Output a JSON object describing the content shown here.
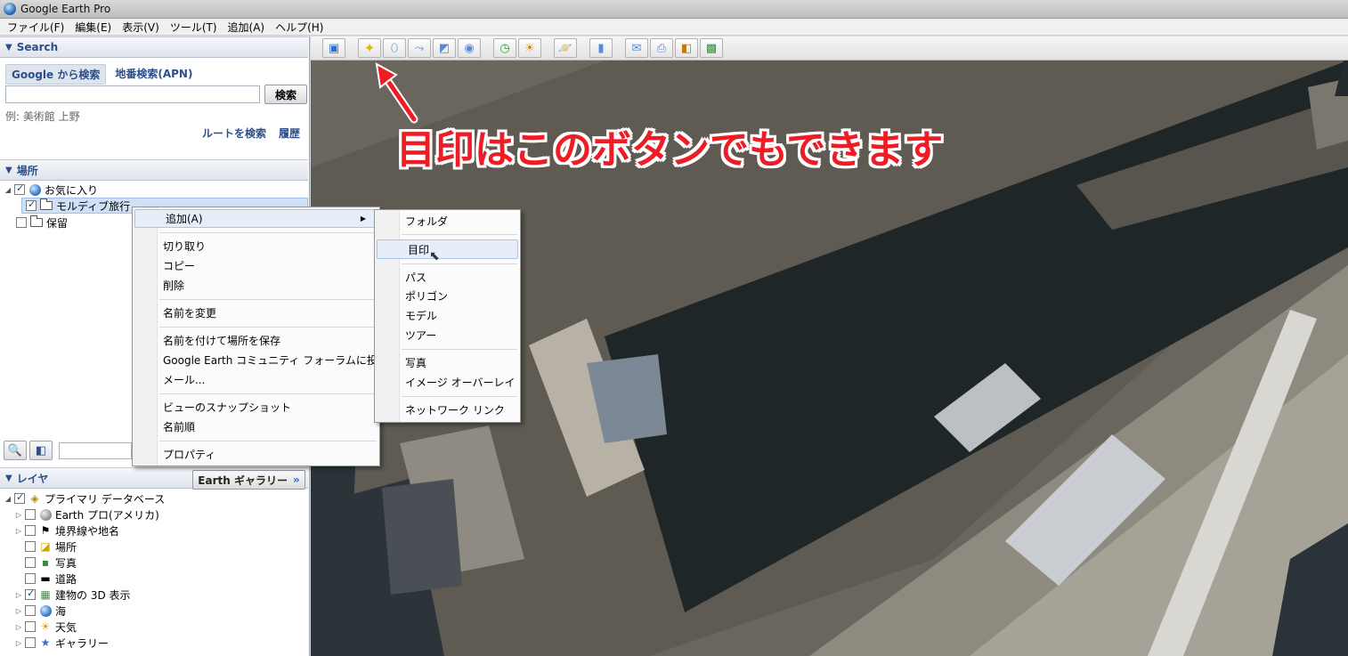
{
  "window": {
    "title": "Google Earth Pro"
  },
  "menu": [
    "ファイル(F)",
    "編集(E)",
    "表示(V)",
    "ツール(T)",
    "追加(A)",
    "ヘルプ(H)"
  ],
  "search": {
    "header": "Search",
    "tabs": [
      "Google から検索",
      "地番検索(APN)"
    ],
    "button": "検索",
    "example": "例: 美術館 上野",
    "route_link": "ルートを検索",
    "history_link": "履歴"
  },
  "places": {
    "header": "場所",
    "items": [
      {
        "label": "お気に入り",
        "checked": true
      },
      {
        "label": "モルディブ旅行",
        "checked": true
      },
      {
        "label": "保留",
        "checked": false
      }
    ]
  },
  "layers": {
    "header": "レイヤ",
    "gallery_button": "Earth ギャラリー",
    "gallery_arrow": "»",
    "items": [
      {
        "label": "プライマリ データベース",
        "checked": true
      },
      {
        "label": "Earth プロ(アメリカ)",
        "checked": false
      },
      {
        "label": "境界線や地名",
        "checked": false
      },
      {
        "label": "場所",
        "checked": false
      },
      {
        "label": "写真",
        "checked": false
      },
      {
        "label": "道路",
        "checked": false
      },
      {
        "label": "建物の 3D 表示",
        "checked": true
      },
      {
        "label": "海",
        "checked": false
      },
      {
        "label": "天気",
        "checked": false
      },
      {
        "label": "ギャラリー",
        "checked": false
      }
    ]
  },
  "context_menu": {
    "items": [
      "追加(A)",
      "切り取り",
      "コピー",
      "削除",
      "名前を変更",
      "名前を付けて場所を保存",
      "Google Earth コミュニティ フォーラムに投稿",
      "メール...",
      "ビューのスナップショット",
      "名前順",
      "プロパティ"
    ]
  },
  "submenu": {
    "items": [
      "フォルダ",
      "目印",
      "パス",
      "ポリゴン",
      "モデル",
      "ツアー",
      "写真",
      "イメージ オーバーレイ",
      "ネットワーク リンク"
    ]
  },
  "annotation": {
    "text": "目印はこのボタンでもできます",
    "color": "#ee1c24"
  }
}
